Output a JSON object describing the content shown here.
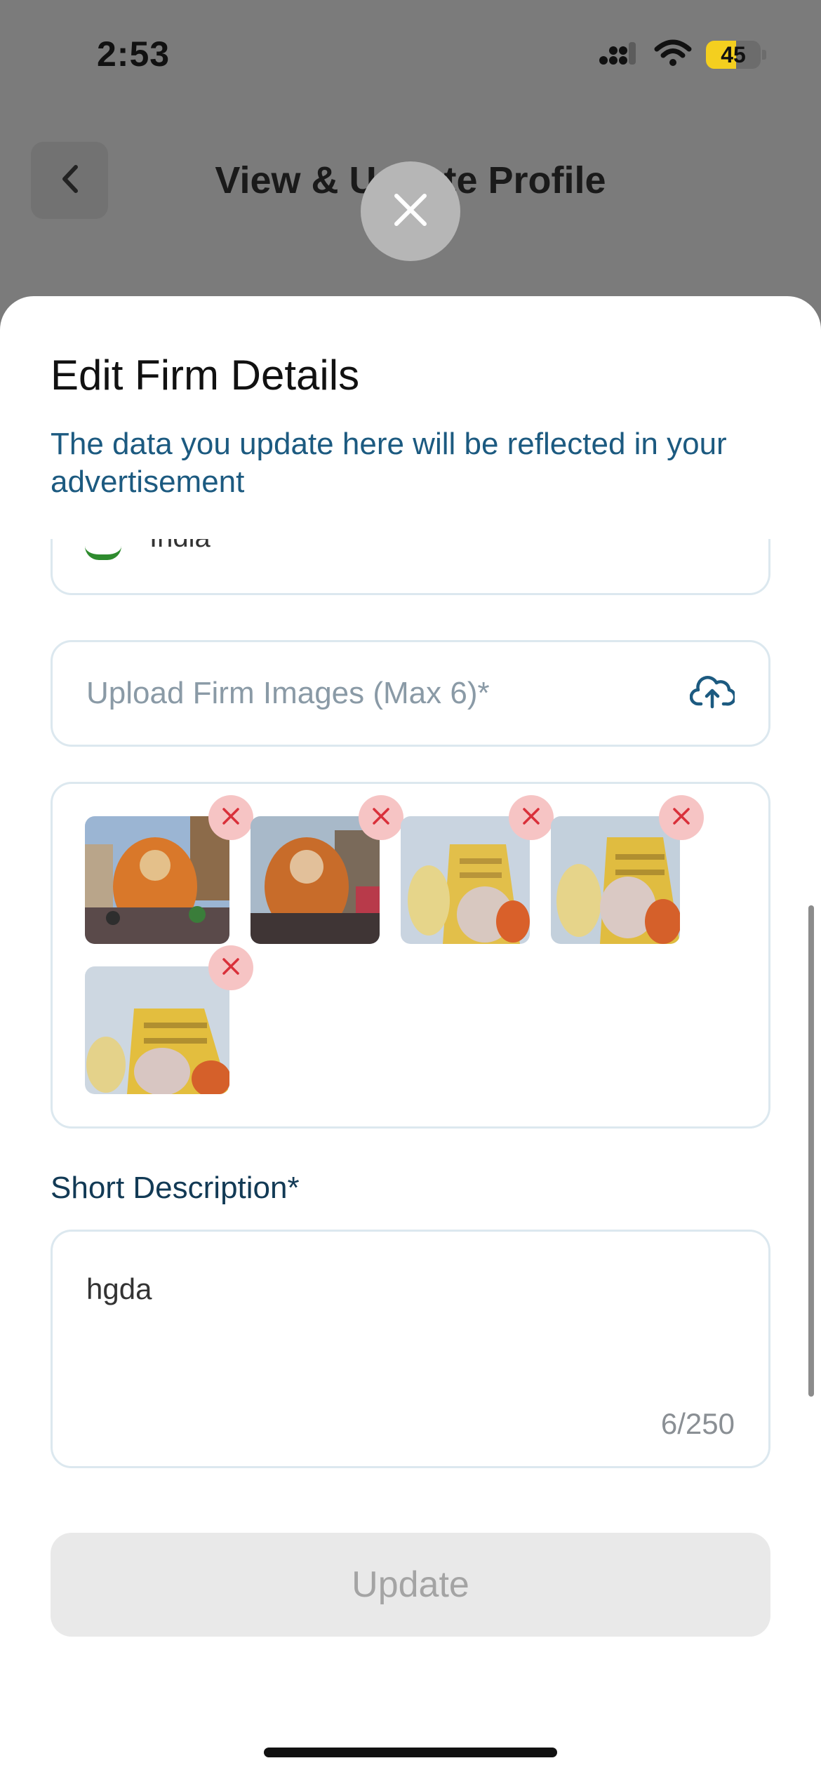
{
  "status_bar": {
    "time": "2:53",
    "battery": "45",
    "icons": [
      "cellular-icon",
      "wifi-icon",
      "battery-icon"
    ]
  },
  "background_page": {
    "title": "View & Update Profile",
    "back_icon": "chevron-left-icon"
  },
  "modal": {
    "close_icon": "close-icon",
    "title": "Edit Firm Details",
    "subtitle": "The data you update here will be reflected in your advertisement",
    "clipped_field_value": "India",
    "upload_field": {
      "placeholder": "Upload Firm Images (Max 6)*",
      "icon": "cloud-upload-icon"
    },
    "images": [
      {
        "name": "firm-image-1",
        "remove_icon": "remove-icon"
      },
      {
        "name": "firm-image-2",
        "remove_icon": "remove-icon"
      },
      {
        "name": "firm-image-3",
        "remove_icon": "remove-icon"
      },
      {
        "name": "firm-image-4",
        "remove_icon": "remove-icon"
      },
      {
        "name": "firm-image-5",
        "remove_icon": "remove-icon"
      }
    ],
    "short_description": {
      "label": "Short Description*",
      "value": "hgda",
      "counter": "6/250"
    },
    "update_button": "Update"
  },
  "colors": {
    "subtitle": "#1c5a80",
    "label": "#123a55",
    "remove_bg": "#f6c4c4",
    "remove_x": "#d9303a",
    "upload_icon": "#1c5a80",
    "disabled_button_bg": "#e9e9e9",
    "disabled_button_text": "#a4a4a4"
  }
}
